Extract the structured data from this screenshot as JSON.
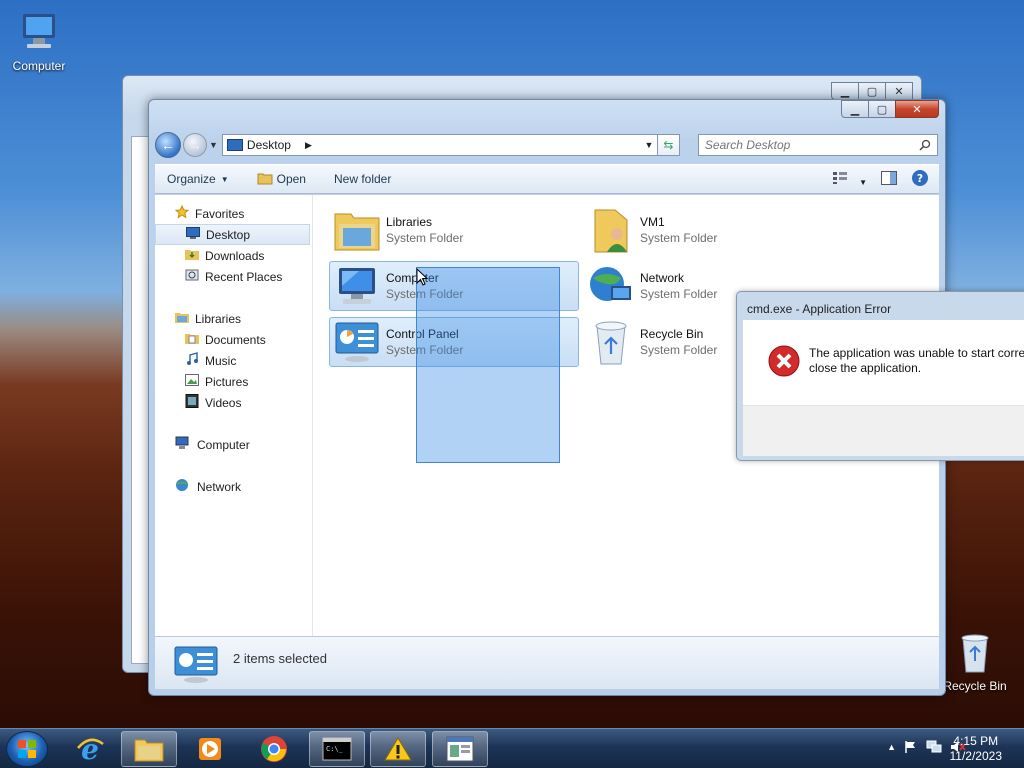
{
  "desktop": {
    "computer_label": "Computer",
    "recycle_label": "Recycle Bin"
  },
  "explorer": {
    "address": "Desktop",
    "search_placeholder": "Search Desktop",
    "toolbar": {
      "organize": "Organize",
      "open": "Open",
      "new_folder": "New folder"
    },
    "nav": {
      "favorites": "Favorites",
      "desktop": "Desktop",
      "downloads": "Downloads",
      "recent": "Recent Places",
      "libraries": "Libraries",
      "documents": "Documents",
      "music": "Music",
      "pictures": "Pictures",
      "videos": "Videos",
      "computer": "Computer",
      "network": "Network"
    },
    "items": [
      {
        "name": "Libraries",
        "type": "System Folder"
      },
      {
        "name": "VM1",
        "type": "System Folder"
      },
      {
        "name": "Computer",
        "type": "System Folder"
      },
      {
        "name": "Network",
        "type": "System Folder"
      },
      {
        "name": "Control Panel",
        "type": "System Folder"
      },
      {
        "name": "Recycle Bin",
        "type": "System Folder"
      }
    ],
    "status": "2 items selected"
  },
  "dialog": {
    "title": "cmd.exe - Application Error",
    "message_line1": "The application was unable to start corre",
    "message_line2": "close the application."
  },
  "taskbar": {
    "time": "4:15 PM",
    "date": "11/2/2023"
  }
}
